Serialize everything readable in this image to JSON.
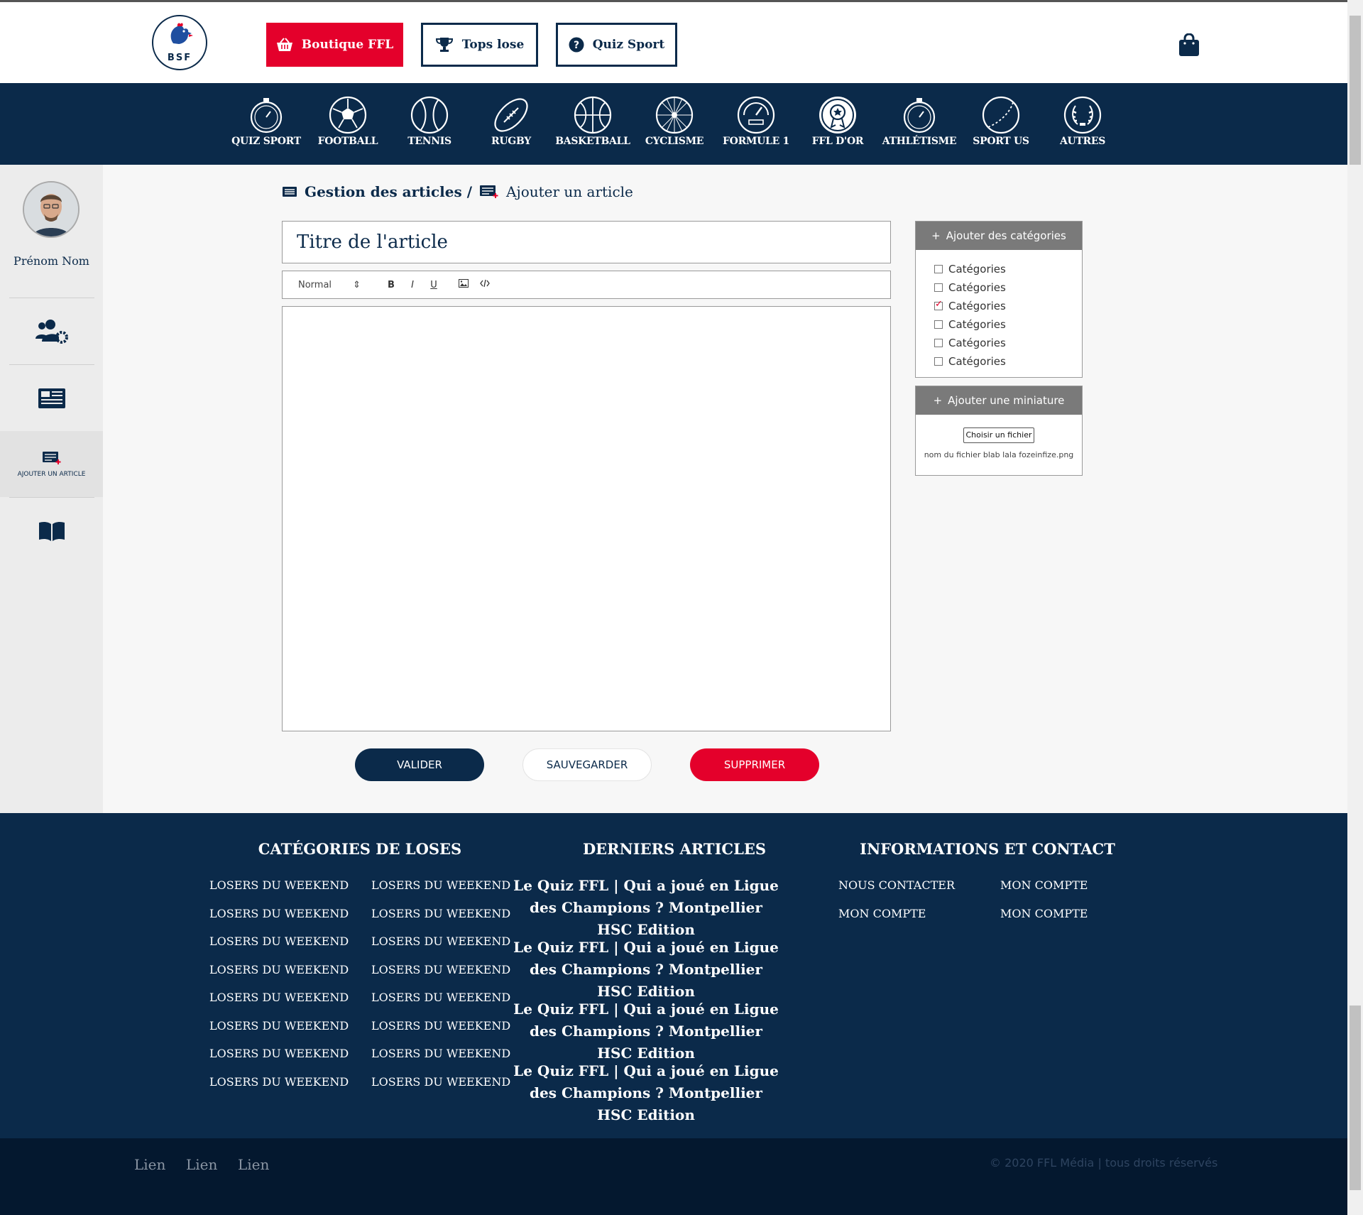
{
  "header": {
    "logo_text": "BSF",
    "buttons": [
      {
        "label": "Boutique FFL",
        "icon": "basket-icon"
      },
      {
        "label": "Tops lose",
        "icon": "trophy-icon"
      },
      {
        "label": "Quiz Sport",
        "icon": "question-circle-icon"
      }
    ],
    "cart_icon": "shopping-bag-icon"
  },
  "sports": [
    {
      "label": "QUIZ SPORT",
      "icon": "stopwatch-icon"
    },
    {
      "label": "FOOTBALL",
      "icon": "soccer-ball-icon"
    },
    {
      "label": "TENNIS",
      "icon": "tennis-ball-icon"
    },
    {
      "label": "RUGBY",
      "icon": "rugby-ball-icon"
    },
    {
      "label": "BASKETBALL",
      "icon": "basketball-icon"
    },
    {
      "label": "CYCLISME",
      "icon": "bicycle-wheel-icon"
    },
    {
      "label": "FORMULE 1",
      "icon": "speedometer-icon"
    },
    {
      "label": "FFL D'OR",
      "icon": "medal-icon"
    },
    {
      "label": "ATHLÉTISME",
      "icon": "stopwatch-icon"
    },
    {
      "label": "SPORT US",
      "icon": "baseball-icon"
    },
    {
      "label": "AUTRES",
      "icon": "laurel-icon"
    }
  ],
  "sidebar": {
    "user_name": "Prénom Nom",
    "items": [
      {
        "icon": "users-cog-icon",
        "label": ""
      },
      {
        "icon": "newspaper-icon",
        "label": ""
      },
      {
        "icon": "add-article-icon",
        "label": "AJOUTER UN ARTICLE",
        "active": true
      },
      {
        "icon": "book-open-icon",
        "label": ""
      }
    ]
  },
  "breadcrumb": {
    "parent": "Gestion des articles /",
    "current": "Ajouter un article"
  },
  "editor": {
    "title_value": "Titre de l'article",
    "format_select": "Normal",
    "tools": [
      "B",
      "I",
      "U"
    ],
    "body": ""
  },
  "actions": {
    "validate": "VALIDER",
    "save": "SAUVEGARDER",
    "delete": "SUPPRIMER"
  },
  "categories_panel": {
    "title": "Ajouter des catégories",
    "items": [
      {
        "label": "Catégories",
        "checked": false
      },
      {
        "label": "Catégories",
        "checked": false
      },
      {
        "label": "Catégories",
        "checked": true
      },
      {
        "label": "Catégories",
        "checked": false
      },
      {
        "label": "Catégories",
        "checked": false
      },
      {
        "label": "Catégories",
        "checked": false
      }
    ]
  },
  "thumbnail_panel": {
    "title": "Ajouter une miniature",
    "button": "Choisir un fichier",
    "file_name": "nom du fichier blab lala fozeinfize.png"
  },
  "footer": {
    "categories_title": "CATÉGORIES DE LOSES",
    "categories": [
      "LOSERS DU WEEKEND",
      "LOSERS DU WEEKEND",
      "LOSERS DU WEEKEND",
      "LOSERS DU WEEKEND",
      "LOSERS DU WEEKEND",
      "LOSERS DU WEEKEND",
      "LOSERS DU WEEKEND",
      "LOSERS DU WEEKEND",
      "LOSERS DU WEEKEND",
      "LOSERS DU WEEKEND",
      "LOSERS DU WEEKEND",
      "LOSERS DU WEEKEND",
      "LOSERS DU WEEKEND",
      "LOSERS DU WEEKEND",
      "LOSERS DU WEEKEND",
      "LOSERS DU WEEKEND"
    ],
    "articles_title": "DERNIERS ARTICLES",
    "articles": [
      "Le Quiz FFL | Qui a joué en Ligue des Champions ? Montpellier HSC Edition",
      "Le Quiz FFL | Qui a joué en Ligue des Champions ? Montpellier HSC Edition",
      "Le Quiz FFL | Qui a joué en Ligue des Champions ? Montpellier HSC Edition",
      "Le Quiz FFL | Qui a joué en Ligue des Champions ? Montpellier HSC Edition"
    ],
    "info_title": "INFORMATIONS ET CONTACT",
    "info_links": [
      "NOUS CONTACTER",
      "MON COMPTE",
      "MON COMPTE",
      "MON COMPTE"
    ]
  },
  "bottom": {
    "links": [
      "Lien",
      "Lien",
      "Lien"
    ],
    "copyright": "© 2020 FFL Média | tous droits réservés"
  },
  "colors": {
    "navy": "#0b2a4a",
    "red": "#e4002b",
    "footer_dark": "#04182f"
  }
}
